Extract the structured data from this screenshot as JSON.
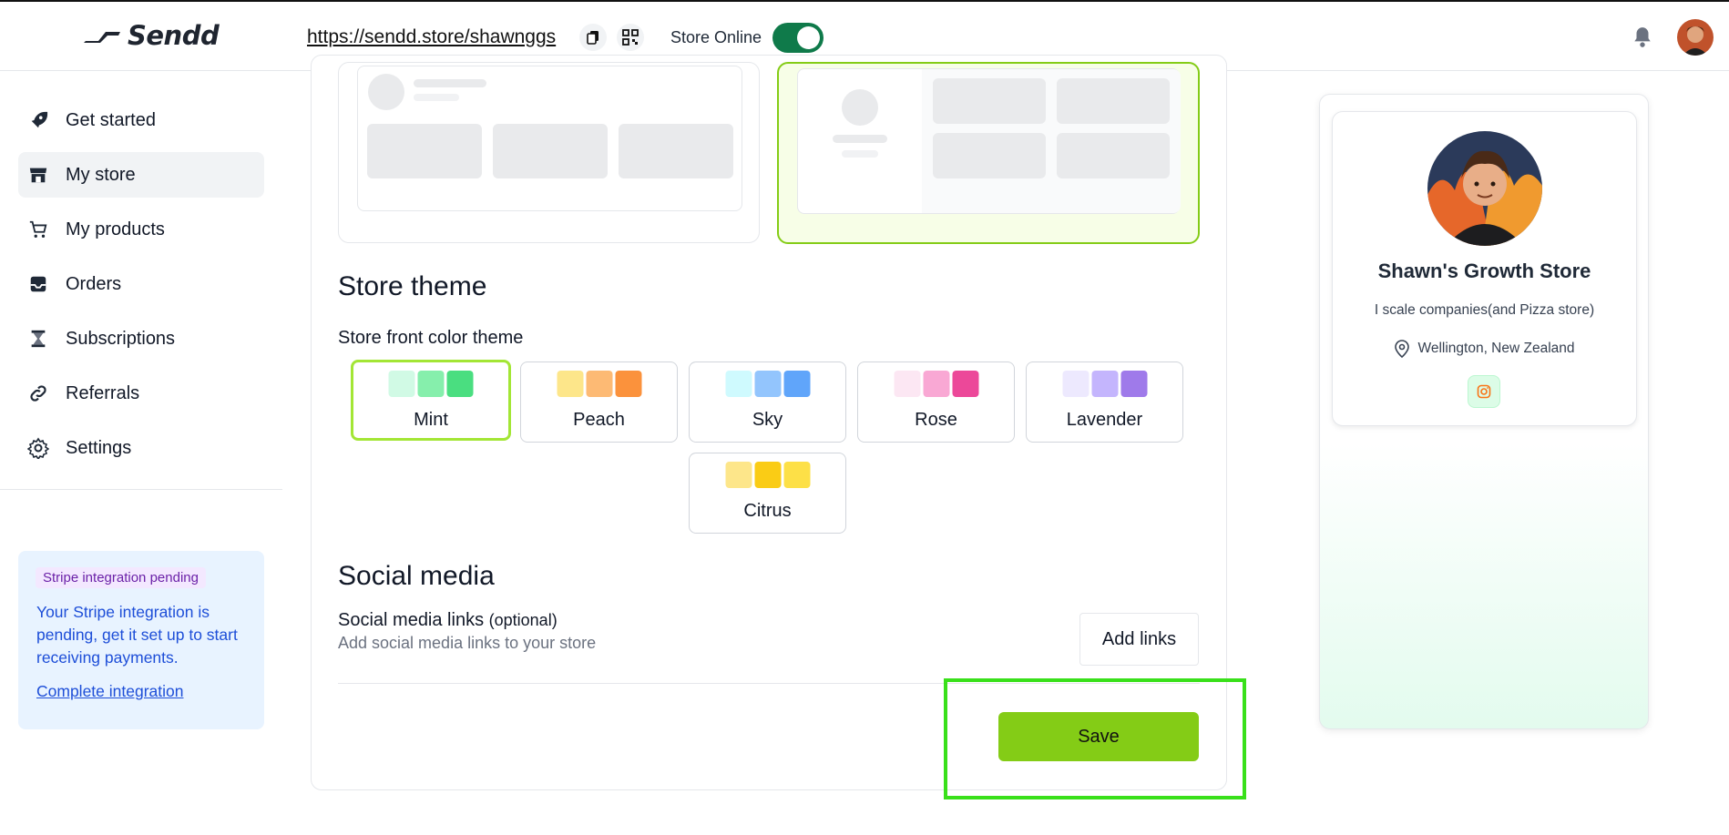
{
  "header": {
    "logo_text": "Sendd",
    "store_url": "https://sendd.store/shawnggs",
    "online_label": "Store Online",
    "online": true
  },
  "sidebar": {
    "items": [
      {
        "label": "Get started",
        "icon": "rocket-icon"
      },
      {
        "label": "My store",
        "icon": "store-icon",
        "active": true
      },
      {
        "label": "My products",
        "icon": "cart-icon"
      },
      {
        "label": "Orders",
        "icon": "inbox-icon"
      },
      {
        "label": "Subscriptions",
        "icon": "hourglass-icon"
      },
      {
        "label": "Referrals",
        "icon": "link-icon"
      },
      {
        "label": "Settings",
        "icon": "gear-icon"
      }
    ],
    "stripe": {
      "badge": "Stripe integration pending",
      "message": "Your Stripe integration is pending, get it set up to start receiving payments.",
      "link": "Complete integration"
    }
  },
  "store_theme": {
    "title": "Store theme",
    "subtitle": "Store front color theme",
    "selected": "Mint",
    "options": [
      {
        "name": "Mint",
        "colors": [
          "#d1fae5",
          "#86efac",
          "#4ade80"
        ]
      },
      {
        "name": "Peach",
        "colors": [
          "#fde68a",
          "#fdba74",
          "#fb923c"
        ]
      },
      {
        "name": "Sky",
        "colors": [
          "#cffafe",
          "#93c5fd",
          "#60a5fa"
        ]
      },
      {
        "name": "Rose",
        "colors": [
          "#fce7f3",
          "#f9a8d4",
          "#ec4899"
        ]
      },
      {
        "name": "Lavender",
        "colors": [
          "#ede9fe",
          "#c4b5fd",
          "#9f7aea"
        ]
      },
      {
        "name": "Citrus",
        "colors": [
          "#fde68a",
          "#facc15",
          "#fde047"
        ]
      }
    ]
  },
  "social": {
    "title": "Social media",
    "links_label": "Social media links",
    "optional": "(optional)",
    "description": "Add social media links to your store",
    "add_button": "Add links"
  },
  "save_label": "Save",
  "preview": {
    "store_name": "Shawn's Growth Store",
    "bio": "I scale companies(and Pizza store)",
    "location": "Wellington, New Zealand",
    "social_icon": "instagram-icon"
  },
  "colors": {
    "accent": "#84cc16",
    "toggle": "#0f7a4a",
    "highlight": "#39e01a"
  }
}
